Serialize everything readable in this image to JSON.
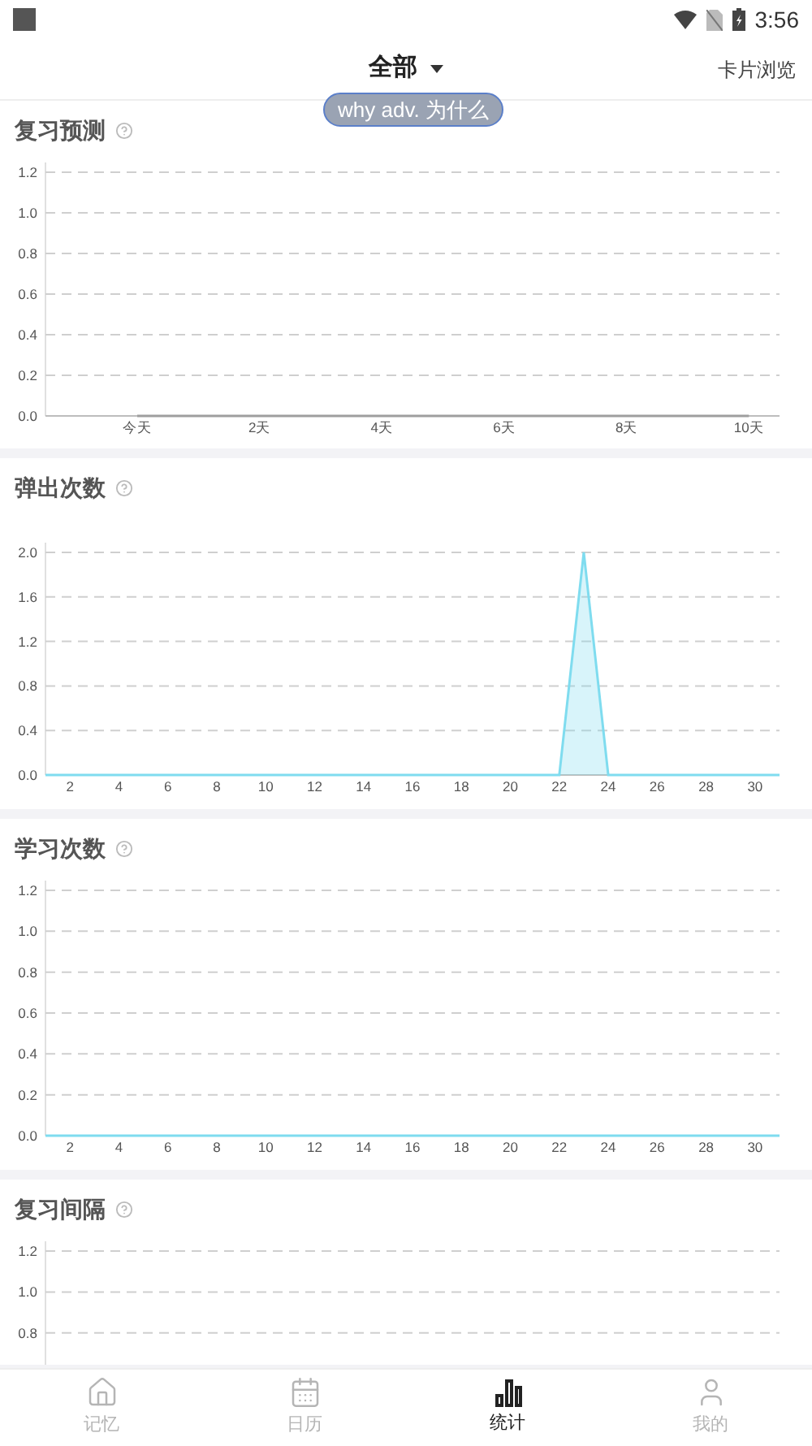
{
  "status_bar": {
    "time": "3:56"
  },
  "header": {
    "title": "全部",
    "right_action": "卡片浏览"
  },
  "tooltip": {
    "text": "why adv. 为什么"
  },
  "sections": [
    {
      "title": "复习预测",
      "chart_data": {
        "type": "line",
        "x": [
          0,
          1,
          2,
          3,
          4,
          5,
          6,
          7,
          8,
          9,
          10
        ],
        "grid": true,
        "series": [
          {
            "color": "#9e9e9e",
            "values": [
              0,
              0,
              0,
              0,
              0,
              0,
              0,
              0,
              0,
              0,
              0
            ]
          }
        ],
        "xlim": [
          -1.5,
          10.5
        ],
        "ylim": [
          0,
          1.2
        ],
        "xticks": [
          {
            "value": 0,
            "label": "今天"
          },
          {
            "value": 2,
            "label": "2天"
          },
          {
            "value": 4,
            "label": "4天"
          },
          {
            "value": 6,
            "label": "6天"
          },
          {
            "value": 8,
            "label": "8天"
          },
          {
            "value": 10,
            "label": "10天"
          }
        ],
        "yticks": [
          {
            "value": 0,
            "label": "0.0"
          },
          {
            "value": 0.2,
            "label": "0.2"
          },
          {
            "value": 0.4,
            "label": "0.4"
          },
          {
            "value": 0.6,
            "label": "0.6"
          },
          {
            "value": 0.8,
            "label": "0.8"
          },
          {
            "value": 1,
            "label": "1.0"
          },
          {
            "value": 1.2,
            "label": "1.2"
          }
        ]
      }
    },
    {
      "title": "弹出次数",
      "chart_data": {
        "type": "area",
        "x": [
          1,
          2,
          3,
          4,
          5,
          6,
          7,
          8,
          9,
          10,
          11,
          12,
          13,
          14,
          15,
          16,
          17,
          18,
          19,
          20,
          21,
          22,
          23,
          24,
          25,
          26,
          27,
          28,
          29,
          30,
          31
        ],
        "grid": true,
        "series": [
          {
            "color": "#7fdcef",
            "values": [
              0,
              0,
              0,
              0,
              0,
              0,
              0,
              0,
              0,
              0,
              0,
              0,
              0,
              0,
              0,
              0,
              0,
              0,
              0,
              0,
              0,
              0,
              2,
              0,
              0,
              0,
              0,
              0,
              0,
              0,
              0
            ]
          }
        ],
        "xlim": [
          1,
          31
        ],
        "ylim": [
          0,
          2
        ],
        "xticks": [
          2,
          4,
          6,
          8,
          10,
          12,
          14,
          16,
          18,
          20,
          22,
          24,
          26,
          28,
          30
        ],
        "yticks": [
          {
            "value": 0,
            "label": "0.0"
          },
          {
            "value": 0.4,
            "label": "0.4"
          },
          {
            "value": 0.8,
            "label": "0.8"
          },
          {
            "value": 1.2,
            "label": "1.2"
          },
          {
            "value": 1.6,
            "label": "1.6"
          },
          {
            "value": 2,
            "label": "2.0"
          }
        ]
      }
    },
    {
      "title": "学习次数",
      "chart_data": {
        "type": "line",
        "x": [
          1,
          2,
          3,
          4,
          5,
          6,
          7,
          8,
          9,
          10,
          11,
          12,
          13,
          14,
          15,
          16,
          17,
          18,
          19,
          20,
          21,
          22,
          23,
          24,
          25,
          26,
          27,
          28,
          29,
          30,
          31
        ],
        "grid": true,
        "series": [
          {
            "color": "#7fdcef",
            "values": [
              0,
              0,
              0,
              0,
              0,
              0,
              0,
              0,
              0,
              0,
              0,
              0,
              0,
              0,
              0,
              0,
              0,
              0,
              0,
              0,
              0,
              0,
              0,
              0,
              0,
              0,
              0,
              0,
              0,
              0,
              0
            ]
          }
        ],
        "xlim": [
          1,
          31
        ],
        "ylim": [
          0,
          1.2
        ],
        "xticks": [
          2,
          4,
          6,
          8,
          10,
          12,
          14,
          16,
          18,
          20,
          22,
          24,
          26,
          28,
          30
        ],
        "yticks": [
          {
            "value": 0,
            "label": "0.0"
          },
          {
            "value": 0.2,
            "label": "0.2"
          },
          {
            "value": 0.4,
            "label": "0.4"
          },
          {
            "value": 0.6,
            "label": "0.6"
          },
          {
            "value": 0.8,
            "label": "0.8"
          },
          {
            "value": 1,
            "label": "1.0"
          },
          {
            "value": 1.2,
            "label": "1.2"
          }
        ]
      }
    },
    {
      "title": "复习间隔",
      "y_labels": [
        "1.2",
        "1.0",
        "0.8"
      ]
    }
  ],
  "bottom_nav": [
    {
      "kind": "home",
      "label": "记忆",
      "selected": false
    },
    {
      "kind": "calendar",
      "label": "日历",
      "selected": false
    },
    {
      "kind": "stats",
      "label": "统计",
      "selected": true
    },
    {
      "kind": "profile",
      "label": "我的",
      "selected": false
    }
  ]
}
